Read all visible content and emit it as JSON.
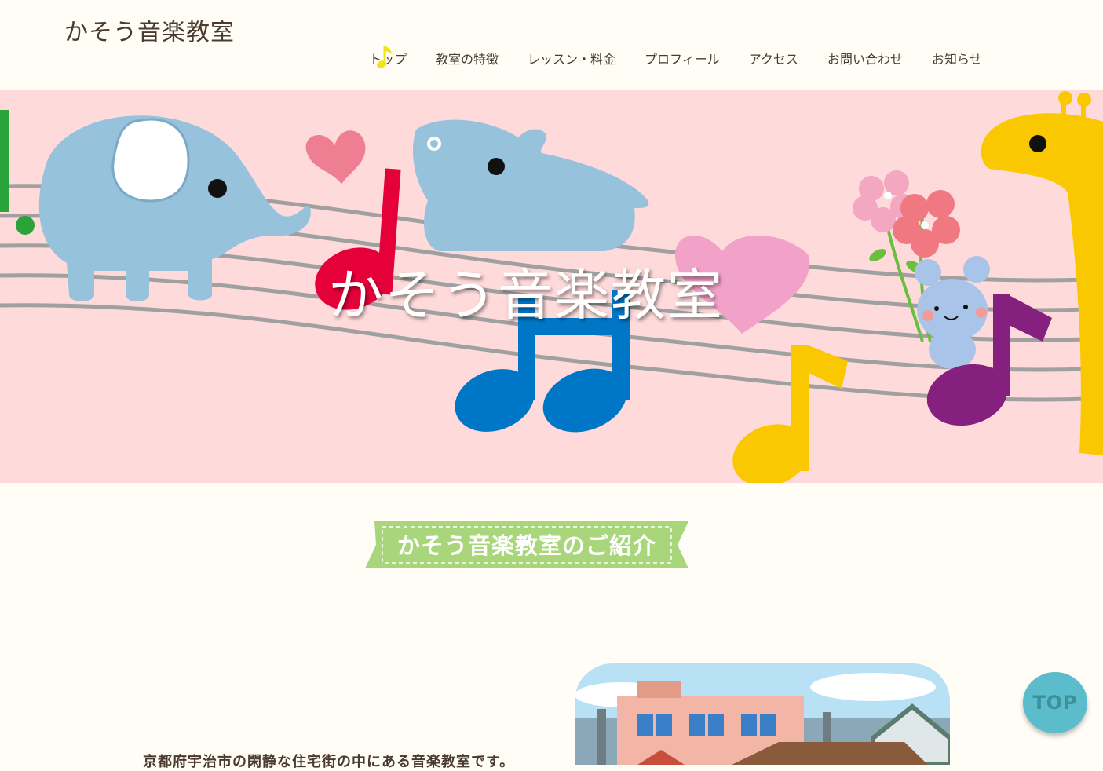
{
  "header": {
    "site_title": "かそう音楽教室",
    "nav": [
      {
        "label": "トップ",
        "active": true
      },
      {
        "label": "教室の特徴"
      },
      {
        "label": "レッスン・料金"
      },
      {
        "label": "プロフィール"
      },
      {
        "label": "アクセス"
      },
      {
        "label": "お問い合わせ"
      },
      {
        "label": "お知らせ"
      }
    ]
  },
  "hero": {
    "title": "かそう音楽教室",
    "background_color": "#fedada"
  },
  "intro": {
    "heading": "かそう音楽教室のご紹介",
    "text": "京都府宇治市の閑静な住宅街の中にある音楽教室です。",
    "ribbon_color": "#a9d67a"
  },
  "top_button": {
    "label": "TOP",
    "color": "#5bbccb"
  }
}
